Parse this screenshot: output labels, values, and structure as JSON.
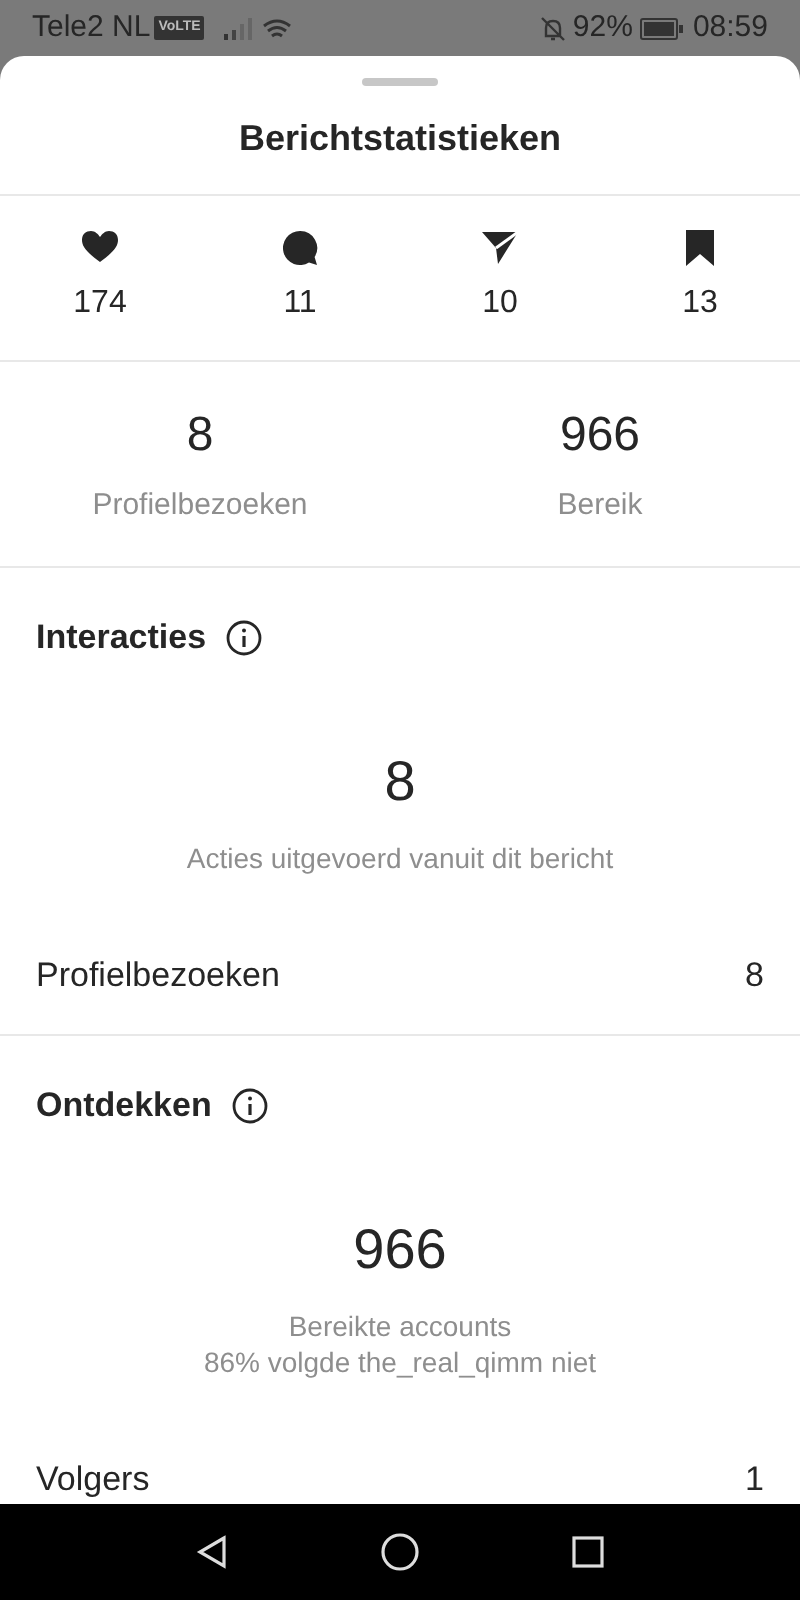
{
  "status_bar": {
    "carrier": "Tele2 NL",
    "network_badge": "VoLTE",
    "battery": "92%",
    "time": "08:59"
  },
  "sheet": {
    "title": "Berichtstatistieken"
  },
  "stats": [
    {
      "kind": "heart",
      "value": "174"
    },
    {
      "kind": "comment",
      "value": "11"
    },
    {
      "kind": "share",
      "value": "10"
    },
    {
      "kind": "save",
      "value": "13"
    }
  ],
  "metrics": [
    {
      "value": "8",
      "label": "Profielbezoeken"
    },
    {
      "value": "966",
      "label": "Bereik"
    }
  ],
  "sections": [
    {
      "title": "Interacties",
      "big_value": "8",
      "captions": [
        "Acties uitgevoerd vanuit dit bericht"
      ],
      "rows": [
        {
          "label": "Profielbezoeken",
          "value": "8"
        }
      ]
    },
    {
      "title": "Ontdekken",
      "big_value": "966",
      "captions": [
        "Bereikte accounts",
        "86% volgde the_real_qimm niet"
      ],
      "rows": [
        {
          "label": "Volgers",
          "value": "1"
        }
      ]
    }
  ]
}
